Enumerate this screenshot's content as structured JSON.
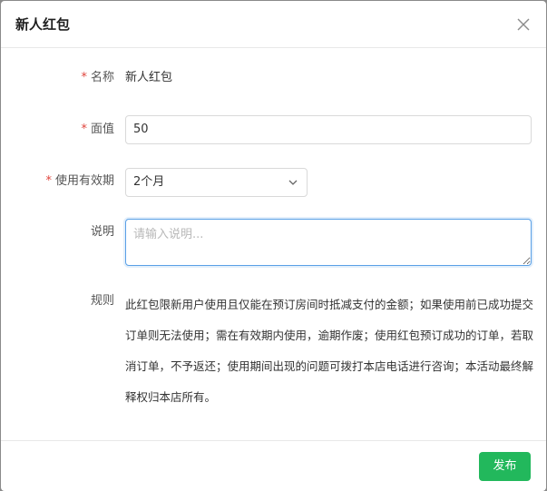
{
  "dialog": {
    "title": "新人红包",
    "close_icon": "close-icon"
  },
  "form": {
    "name": {
      "required_mark": "*",
      "label": "名称",
      "value": "新人红包"
    },
    "face_value": {
      "required_mark": "*",
      "label": "面值",
      "value": "50"
    },
    "validity": {
      "required_mark": "*",
      "label": "使用有效期",
      "selected": "2个月",
      "arrow_icon": "chevron-down-icon"
    },
    "description": {
      "label": "说明",
      "value": "",
      "placeholder": "请输入说明..."
    },
    "rules": {
      "label": "规则",
      "text": "此红包限新用户使用且仅能在预订房间时抵减支付的金额；如果使用前已成功提交订单则无法使用；需在有效期内使用，逾期作废；使用红包预订成功的订单，若取消订单，不予返还；使用期间出现的问题可拨打本店电话进行咨询；本活动最终解释权归本店所有。"
    }
  },
  "footer": {
    "publish_label": "发布"
  },
  "colors": {
    "accent": "#22b85c",
    "required": "#e0443d",
    "focus_border": "#5aa0e6"
  }
}
